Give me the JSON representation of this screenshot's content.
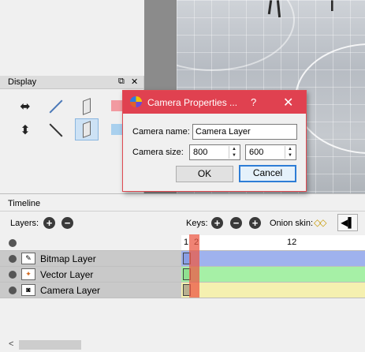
{
  "display_panel": {
    "title": "Display",
    "float_icon": "restore-icon",
    "close_icon": "close-icon",
    "chip_colors": [
      "#f29aa1",
      "#a9d0ee",
      "#d48ed9"
    ]
  },
  "dialog": {
    "title": "Camera Properties ...",
    "help": "?",
    "close": "✕",
    "name_label": "Camera name:",
    "name_value": "Camera Layer",
    "size_label": "Camera size:",
    "width_value": "800",
    "height_value": "600",
    "ok_label": "OK",
    "cancel_label": "Cancel",
    "title_color": "#e04150"
  },
  "timeline": {
    "title": "Timeline",
    "layers_label": "Layers:",
    "keys_label": "Keys:",
    "onion_label": "Onion skin:",
    "ruler": [
      "1",
      "2",
      "12"
    ],
    "current_frame": 2,
    "layers": [
      {
        "name": "Bitmap Layer",
        "icon": "bitmap-layer-icon",
        "color": "#9fb2ee"
      },
      {
        "name": "Vector Layer",
        "icon": "vector-layer-icon",
        "color": "#a6f0a6"
      },
      {
        "name": "Camera Layer",
        "icon": "camera-layer-icon",
        "color": "#f5f0b0"
      }
    ]
  }
}
